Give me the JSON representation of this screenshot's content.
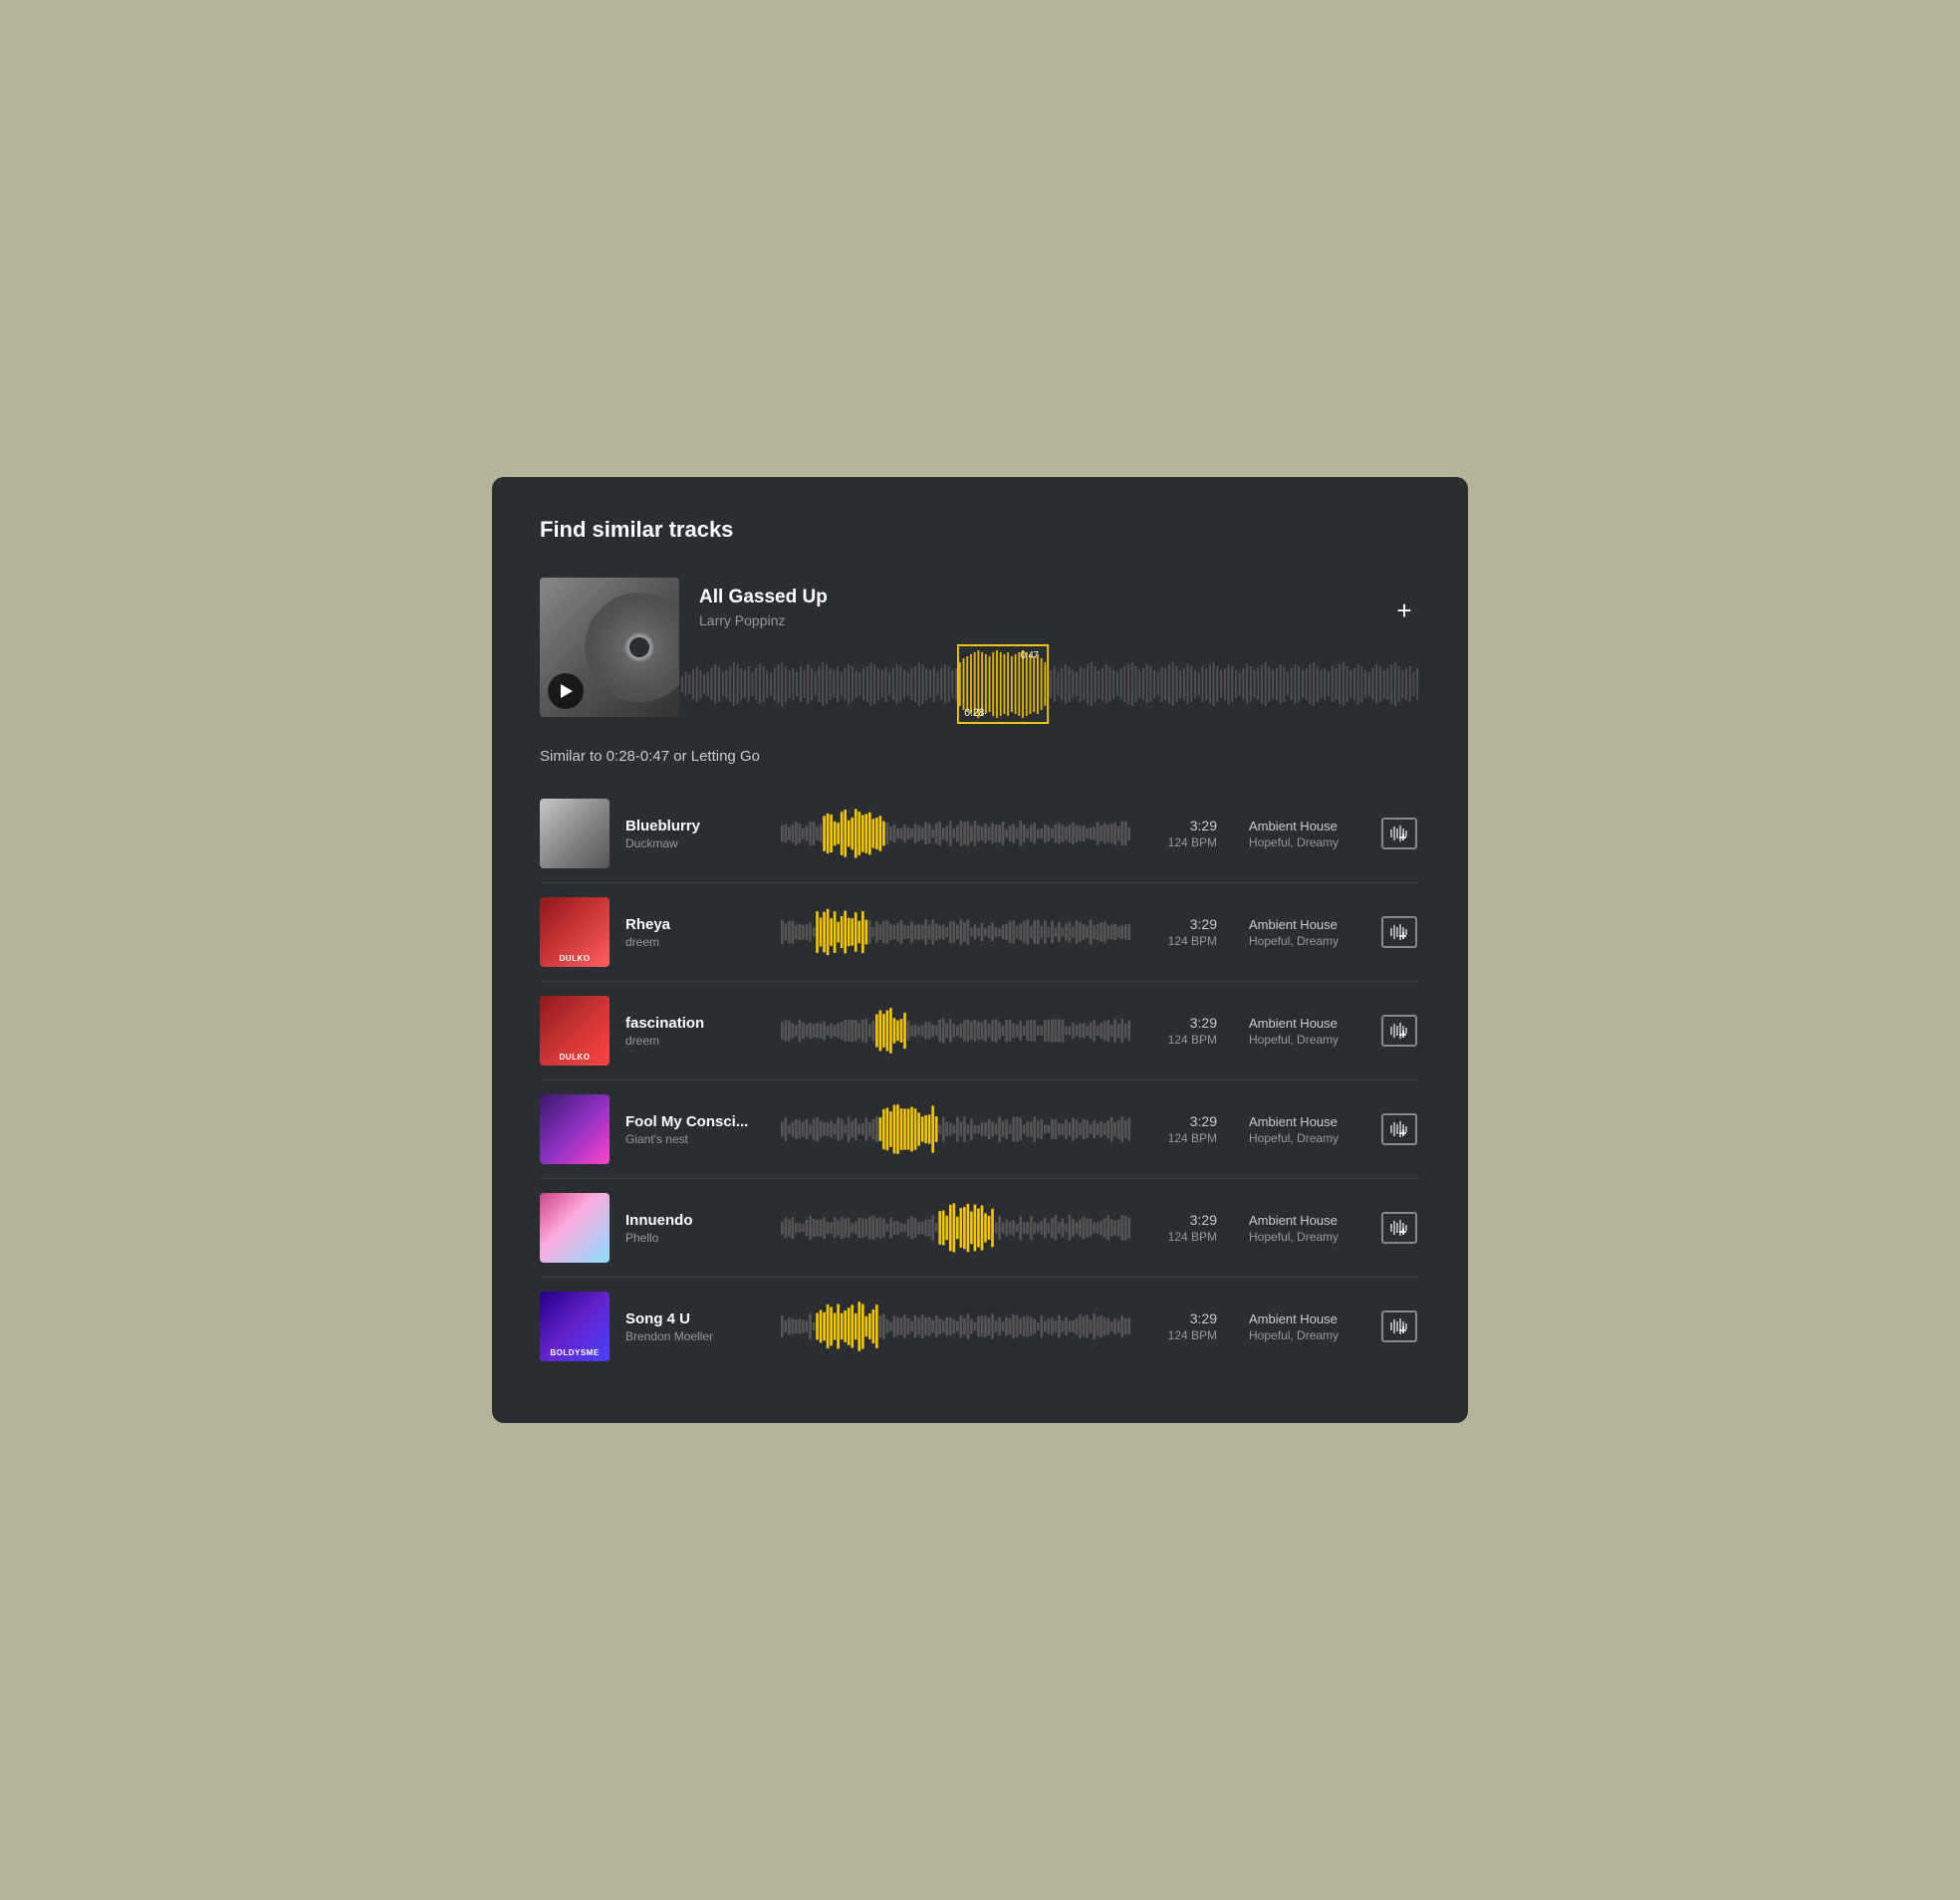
{
  "panel": {
    "title": "Find similar tracks"
  },
  "source": {
    "title": "All Gassed Up",
    "artist": "Larry Poppinz",
    "selection_start": "0:28",
    "selection_end": "0:47",
    "add_button_label": "+"
  },
  "similar_label": "Similar to 0:28-0:47 or Letting Go",
  "tracks": [
    {
      "id": "blueblurry",
      "title": "Blueblurry",
      "artist": "Duckmaw",
      "duration": "3:29",
      "bpm": "124 BPM",
      "genre": "Ambient House",
      "mood": "Hopeful, Dreamy",
      "highlight_position": 0.12,
      "highlight_width": 0.18,
      "thumb_class": "thumb-blueblurry",
      "thumb_label": ""
    },
    {
      "id": "rheya",
      "title": "Rheya",
      "artist": "dreem",
      "duration": "3:29",
      "bpm": "124 BPM",
      "genre": "Ambient House",
      "mood": "Hopeful, Dreamy",
      "highlight_position": 0.1,
      "highlight_width": 0.14,
      "thumb_class": "thumb-rheya",
      "thumb_label": "DULKO"
    },
    {
      "id": "fascination",
      "title": "fascination",
      "artist": "dreem",
      "duration": "3:29",
      "bpm": "124 BPM",
      "genre": "Ambient House",
      "mood": "Hopeful, Dreamy",
      "highlight_position": 0.27,
      "highlight_width": 0.09,
      "thumb_class": "thumb-fascination",
      "thumb_label": "DULKO"
    },
    {
      "id": "fool",
      "title": "Fool My Consci...",
      "artist": "Giant's nest",
      "duration": "3:29",
      "bpm": "124 BPM",
      "genre": "Ambient House",
      "mood": "Hopeful, Dreamy",
      "highlight_position": 0.28,
      "highlight_width": 0.16,
      "thumb_class": "thumb-fool",
      "thumb_label": ""
    },
    {
      "id": "innuendo",
      "title": "Innuendo",
      "artist": "Phello",
      "duration": "3:29",
      "bpm": "124 BPM",
      "genre": "Ambient House",
      "mood": "Hopeful, Dreamy",
      "highlight_position": 0.45,
      "highlight_width": 0.16,
      "thumb_class": "thumb-innuendo",
      "thumb_label": ""
    },
    {
      "id": "song4u",
      "title": "Song 4 U",
      "artist": "Brendon Moeller",
      "duration": "3:29",
      "bpm": "124 BPM",
      "genre": "Ambient House",
      "mood": "Hopeful, Dreamy",
      "highlight_position": 0.1,
      "highlight_width": 0.18,
      "thumb_class": "thumb-song4u",
      "thumb_label": "BOLDYSME"
    }
  ]
}
